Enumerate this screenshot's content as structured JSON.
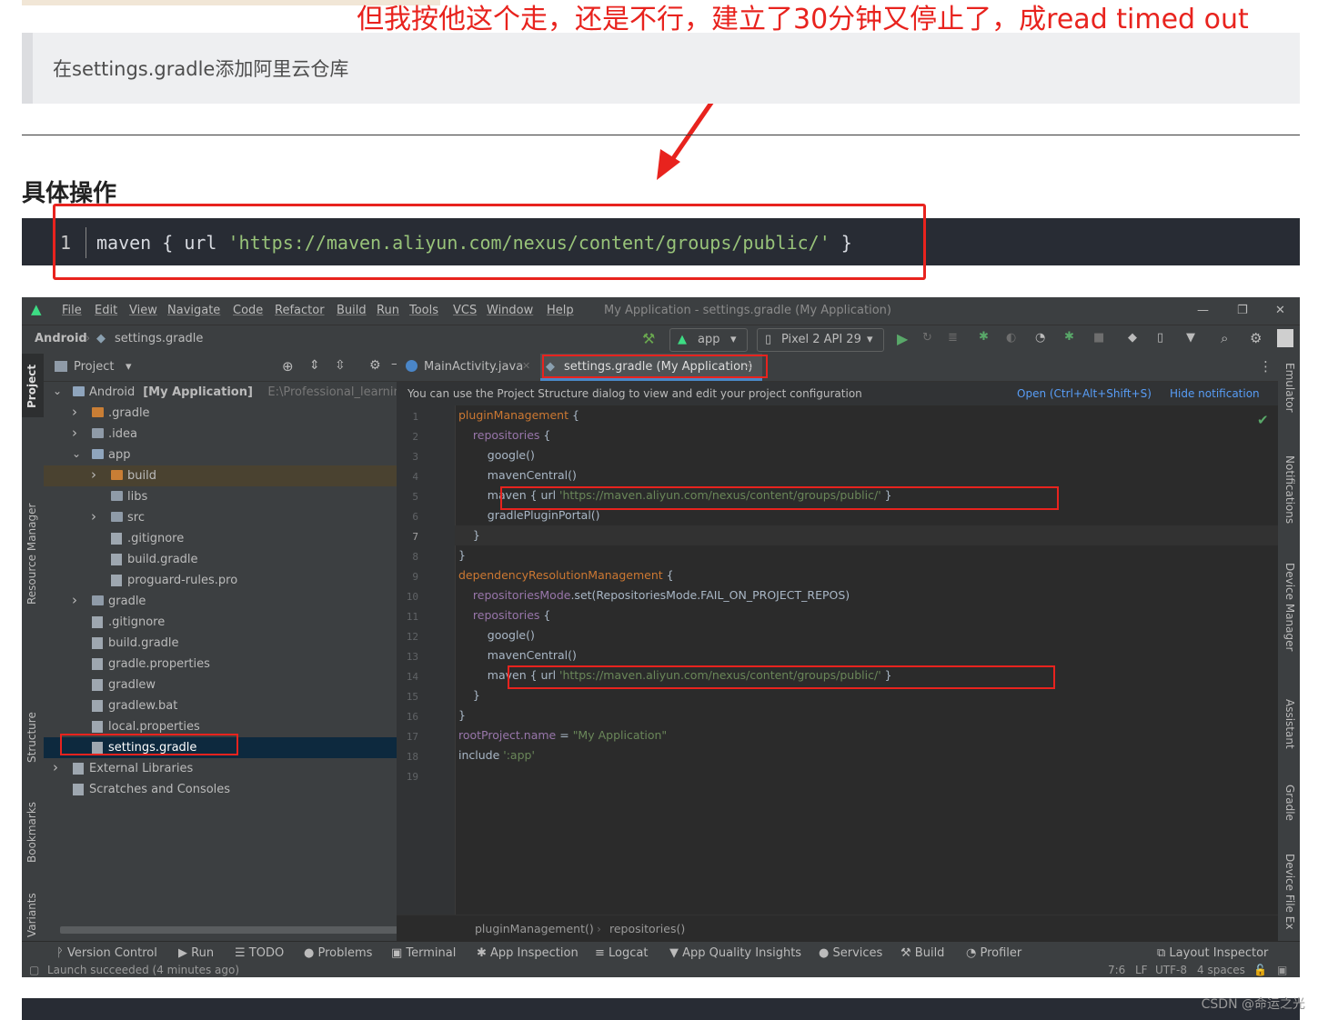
{
  "annotation": "但我按他这个走，还是不行，建立了30分钟又停止了，成read timed out",
  "quote": "在settings.gradle添加阿里云仓库",
  "heading": "具体操作",
  "codeblock": {
    "line_number": "1",
    "prefix": "maven { url ",
    "url": "'https://maven.aliyun.com/nexus/content/groups/public/'",
    "suffix": " }"
  },
  "ide": {
    "menu": [
      "File",
      "Edit",
      "View",
      "Navigate",
      "Code",
      "Refactor",
      "Build",
      "Run",
      "Tools",
      "VCS",
      "Window",
      "Help"
    ],
    "window_title": "My Application - settings.gradle (My Application)",
    "breadcrumb_root": "Android",
    "breadcrumb_file": "settings.gradle",
    "run_config": "app",
    "device": "Pixel 2 API 29",
    "project_dropdown": "Project",
    "left_tools": [
      "Project",
      "Resource Manager",
      "Structure",
      "Bookmarks",
      "Build Variants"
    ],
    "right_tools": [
      "Emulator",
      "Notifications",
      "Device Manager",
      "Assistant",
      "Gradle",
      "Device File Ex"
    ],
    "tree": [
      {
        "label": "Android",
        "bold": "[My Application]",
        "path": "E:\\Professional_learning\\Andr",
        "depth": 0,
        "chev": "v"
      },
      {
        "label": ".gradle",
        "depth": 1,
        "chev": ">",
        "icon": "orange"
      },
      {
        "label": ".idea",
        "depth": 1,
        "chev": ">",
        "icon": "gray"
      },
      {
        "label": "app",
        "depth": 1,
        "chev": "v",
        "icon": "blue"
      },
      {
        "label": "build",
        "depth": 2,
        "chev": ">",
        "icon": "orange"
      },
      {
        "label": "libs",
        "depth": 2,
        "chev": "",
        "icon": "gray"
      },
      {
        "label": "src",
        "depth": 2,
        "chev": ">",
        "icon": "gray"
      },
      {
        "label": ".gitignore",
        "depth": 2,
        "chev": "",
        "icon": "file"
      },
      {
        "label": "build.gradle",
        "depth": 2,
        "chev": "",
        "icon": "file"
      },
      {
        "label": "proguard-rules.pro",
        "depth": 2,
        "chev": "",
        "icon": "file"
      },
      {
        "label": "gradle",
        "depth": 1,
        "chev": ">",
        "icon": "gray"
      },
      {
        "label": ".gitignore",
        "depth": 1,
        "chev": "",
        "icon": "file"
      },
      {
        "label": "build.gradle",
        "depth": 1,
        "chev": "",
        "icon": "file"
      },
      {
        "label": "gradle.properties",
        "depth": 1,
        "chev": "",
        "icon": "file"
      },
      {
        "label": "gradlew",
        "depth": 1,
        "chev": "",
        "icon": "file"
      },
      {
        "label": "gradlew.bat",
        "depth": 1,
        "chev": "",
        "icon": "file"
      },
      {
        "label": "local.properties",
        "depth": 1,
        "chev": "",
        "icon": "file"
      },
      {
        "label": "settings.gradle",
        "depth": 1,
        "chev": "",
        "icon": "file",
        "selected": true
      },
      {
        "label": "External Libraries",
        "depth": 0,
        "chev": ">",
        "icon": "lib"
      },
      {
        "label": "Scratches and Consoles",
        "depth": 0,
        "chev": "",
        "icon": "scratch"
      }
    ],
    "tabs": [
      "MainActivity.java",
      "settings.gradle (My Application)"
    ],
    "notification": "You can use the Project Structure dialog to view and edit your project configuration",
    "notif_open": "Open (Ctrl+Alt+Shift+S)",
    "notif_hide": "Hide notification",
    "code": [
      [
        [
          "kw",
          "pluginManagement"
        ],
        [
          "fn",
          " {"
        ]
      ],
      [
        [
          "fn",
          "    "
        ],
        [
          "pv",
          "repositories"
        ],
        [
          "fn",
          " {"
        ]
      ],
      [
        [
          "fn",
          "        google()"
        ]
      ],
      [
        [
          "fn",
          "        mavenCentral()"
        ]
      ],
      [
        [
          "fn",
          "        maven { url "
        ],
        [
          "st",
          "'https://maven.aliyun.com/nexus/content/groups/public/'"
        ],
        [
          "fn",
          " }"
        ]
      ],
      [
        [
          "fn",
          "        gradlePluginPortal()"
        ]
      ],
      [
        [
          "fn",
          "    }"
        ]
      ],
      [
        [
          "fn",
          "}"
        ]
      ],
      [
        [
          "kw",
          "dependencyResolutionManagement"
        ],
        [
          "fn",
          " {"
        ]
      ],
      [
        [
          "fn",
          "    "
        ],
        [
          "pv",
          "repositoriesMode"
        ],
        [
          "fn",
          ".set(RepositoriesMode.FAIL_ON_PROJECT_REPOS)"
        ]
      ],
      [
        [
          "fn",
          "    "
        ],
        [
          "pv",
          "repositories"
        ],
        [
          "fn",
          " {"
        ]
      ],
      [
        [
          "fn",
          "        google()"
        ]
      ],
      [
        [
          "fn",
          "        mavenCentral()"
        ]
      ],
      [
        [
          "fn",
          "        maven { url "
        ],
        [
          "st",
          "'https://maven.aliyun.com/nexus/content/groups/public/'"
        ],
        [
          "fn",
          " }"
        ]
      ],
      [
        [
          "fn",
          "    }"
        ]
      ],
      [
        [
          "fn",
          "}"
        ]
      ],
      [
        [
          "pv",
          "rootProject.name"
        ],
        [
          "fn",
          " = "
        ],
        [
          "st",
          "\"My Application\""
        ]
      ],
      [
        [
          "fn",
          "include "
        ],
        [
          "st",
          "':app'"
        ]
      ],
      [
        [
          "fn",
          ""
        ]
      ]
    ],
    "editor_breadcrumb": [
      "pluginManagement()",
      "repositories()"
    ],
    "tool_windows": [
      "Version Control",
      "Run",
      "TODO",
      "Problems",
      "Terminal",
      "App Inspection",
      "Logcat",
      "App Quality Insights",
      "Services",
      "Build",
      "Profiler",
      "Layout Inspector"
    ],
    "status_left": "Launch succeeded (4 minutes ago)",
    "status_right": [
      "7:6",
      "LF",
      "UTF-8",
      "4 spaces"
    ]
  },
  "watermark": "CSDN @命运之光",
  "colors": {
    "annotation_red": "#e8231e",
    "ide_bg": "#2b2b2b",
    "panel_bg": "#3c3f41",
    "string_green": "#6a8759",
    "keyword_orange": "#cc7832"
  }
}
